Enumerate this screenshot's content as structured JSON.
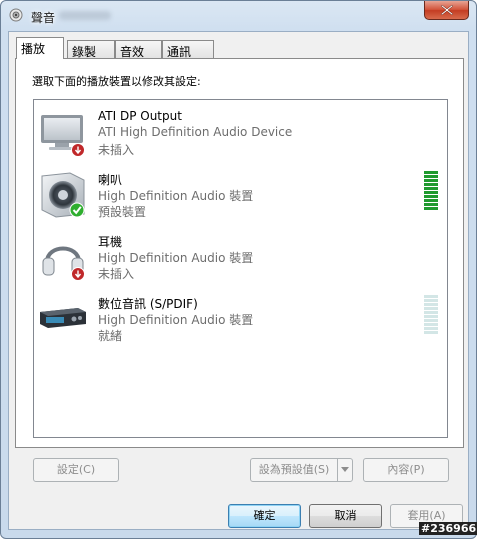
{
  "window": {
    "title": "聲音"
  },
  "tabs": [
    {
      "label": "播放",
      "active": true
    },
    {
      "label": "錄製",
      "active": false
    },
    {
      "label": "音效",
      "active": false
    },
    {
      "label": "通訊",
      "active": false
    }
  ],
  "instruction": "選取下面的播放裝置以修改其設定:",
  "devices": [
    {
      "name": "ATI DP Output",
      "description": "ATI High Definition Audio Device",
      "status": "未插入",
      "icon": "monitor-icon",
      "badge": "unplugged-badge-icon",
      "level": 0
    },
    {
      "name": "喇叭",
      "description": "High Definition Audio 裝置",
      "status": "預設裝置",
      "icon": "speaker-icon",
      "badge": "default-check-badge-icon",
      "level": 1.0
    },
    {
      "name": "耳機",
      "description": "High Definition Audio 裝置",
      "status": "未插入",
      "icon": "headphones-icon",
      "badge": "unplugged-badge-icon",
      "level": 0
    },
    {
      "name": "數位音訊 (S/PDIF)",
      "description": "High Definition Audio 裝置",
      "status": "就緒",
      "icon": "digital-audio-device-icon",
      "badge": "",
      "level": 0
    }
  ],
  "buttons": {
    "configure": "設定(C)",
    "set_default": "設為預設值(S)",
    "properties": "內容(P)",
    "ok": "確定",
    "cancel": "取消",
    "apply": "套用(A)"
  },
  "watermark": "#236966",
  "colors": {
    "meter_active": "#1f9a2e",
    "meter_inactive": "#d3e6e6",
    "check_green": "#2fae2f",
    "unplugged_red": "#c0282a"
  }
}
